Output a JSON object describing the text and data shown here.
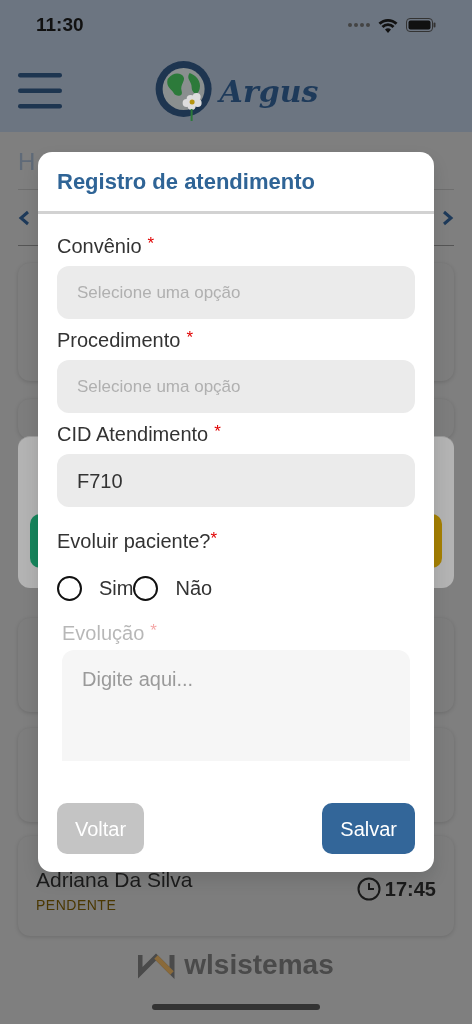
{
  "status_bar": {
    "time": "11:30"
  },
  "header": {
    "brand": "Argus"
  },
  "page": {
    "heading": "H",
    "records": [
      {
        "name": "Adriana Da Silva",
        "status": "PENDENTE",
        "time": "17:45"
      }
    ]
  },
  "footer": {
    "brand": "wlsistemas"
  },
  "modal": {
    "title": "Registro de atendimento",
    "fields": [
      {
        "kind": "select",
        "label": "Convênio",
        "required_mark": "*",
        "placeholder": "Selecione uma opção"
      },
      {
        "kind": "select",
        "label": "Procedimento",
        "required_mark": "*",
        "placeholder": "Selecione uma opção"
      },
      {
        "kind": "text",
        "label": "CID Atendimento",
        "required_mark": "*",
        "value": "F710"
      },
      {
        "kind": "radio",
        "label": "Evoluir paciente?",
        "required_mark": "*",
        "options": [
          {
            "label": "Sim",
            "selected": false
          },
          {
            "label": "Não",
            "selected": false
          }
        ]
      },
      {
        "kind": "textarea",
        "label": "Evolução",
        "required_mark": "*",
        "disabled": true,
        "placeholder": "Digite aqui..."
      }
    ],
    "buttons": [
      {
        "label": "Voltar",
        "kind": "secondary"
      },
      {
        "label": "Salvar",
        "kind": "primary"
      }
    ]
  }
}
